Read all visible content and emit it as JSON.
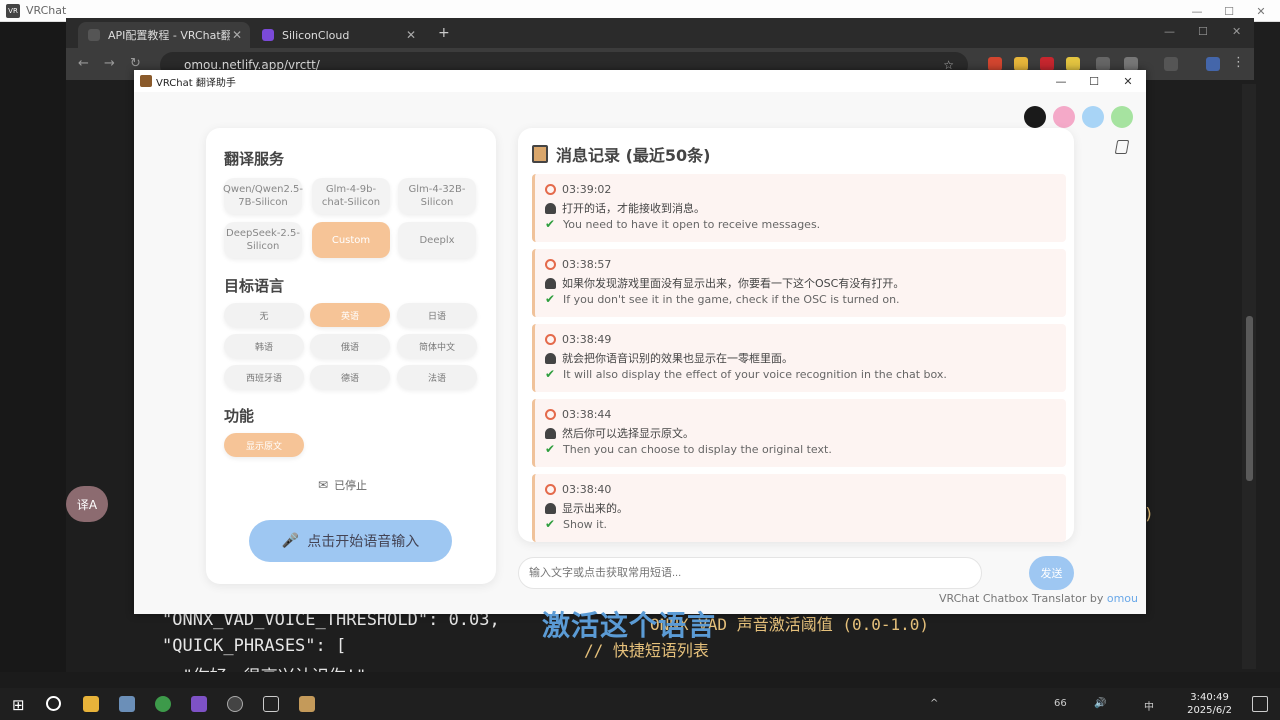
{
  "outer_window": {
    "title": "VRChat"
  },
  "browser": {
    "tabs": [
      {
        "label": "API配置教程 - VRChat翻译工具",
        "close": "✕"
      },
      {
        "label": "SiliconCloud",
        "close": "✕"
      }
    ],
    "new_tab": "+",
    "url": "omou.netlify.app/vrctt/"
  },
  "app": {
    "title": "VRChat 翻译助手",
    "theme_colors": [
      "#1a1a1a",
      "#f4a9c8",
      "#a8d4f6",
      "#a6e3a0"
    ],
    "translation_service": {
      "heading": "翻译服务",
      "options": [
        "Qwen/Qwen2.5-7B-Silicon",
        "Glm-4-9b-chat-Silicon",
        "Glm-4-32B-Silicon",
        "DeepSeek-2.5-Silicon",
        "Custom",
        "Deeplx"
      ],
      "selected": "Custom"
    },
    "target_language": {
      "heading": "目标语言",
      "options": [
        "无",
        "英语",
        "日语",
        "韩语",
        "俄语",
        "简体中文",
        "西班牙语",
        "德语",
        "法语"
      ],
      "selected": "英语"
    },
    "features": {
      "heading": "功能",
      "show_original": "显示原文"
    },
    "status": "已停止",
    "voice_button": "点击开始语音输入",
    "log": {
      "title": "消息记录 (最近50条)",
      "messages": [
        {
          "time": "03:39:02",
          "original": "打开的话，才能接收到消息。",
          "translation": "You need to have it open to receive messages."
        },
        {
          "time": "03:38:57",
          "original": "如果你发现游戏里面没有显示出来，你要看一下这个OSC有没有打开。",
          "translation": "If you don't see it in the game, check if the OSC is turned on."
        },
        {
          "time": "03:38:49",
          "original": "就会把你语音识别的效果也显示在一零框里面。",
          "translation": "It will also display the effect of your voice recognition in the chat box."
        },
        {
          "time": "03:38:44",
          "original": "然后你可以选择显示原文。",
          "translation": "Then you can choose to display the original text."
        },
        {
          "time": "03:38:40",
          "original": "显示出来的。",
          "translation": "Show it."
        }
      ]
    },
    "input_placeholder": "输入文字或点击获取常用短语...",
    "send_button": "发送",
    "footer": {
      "text": "VRChat Chatbox Translator by",
      "link": "omou"
    },
    "floating_button": "译A"
  },
  "editor": {
    "line1": "\"ONNX_VAD_VOICE_THRESHOLD\": 0.03,",
    "line1_comment": "ONNX VAD 声音激活阈值 (0.0-1.0)",
    "line2": "\"QUICK_PHRASES\": [",
    "line2_comment": "// 快捷短语列表",
    "line3": "  \"你好，很高兴认识你!\",",
    "stray": ")"
  },
  "video_subtitle": "激活这个语言",
  "taskbar": {
    "time": "3:40:49",
    "date": "2025/6/2",
    "tray_number": "66",
    "ime": "中"
  }
}
